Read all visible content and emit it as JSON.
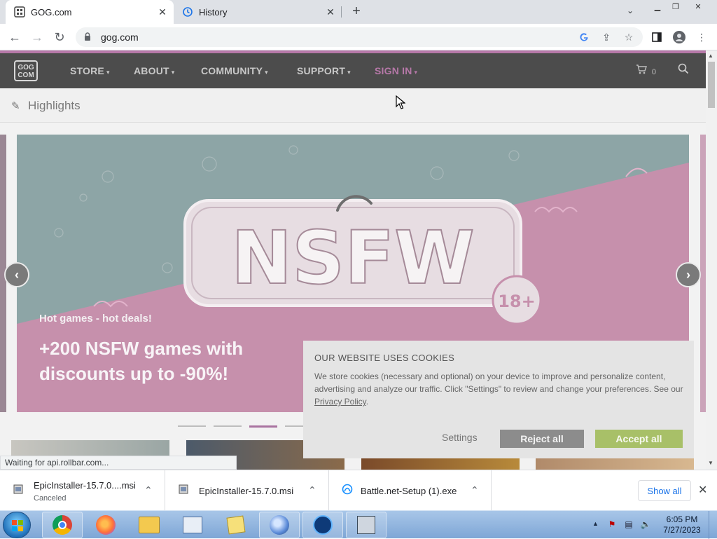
{
  "browser": {
    "tabs": [
      {
        "title": "GOG.com",
        "active": true
      },
      {
        "title": "History",
        "active": false
      }
    ],
    "url": "gog.com"
  },
  "gog": {
    "logo_text": "GOG COM",
    "menu": [
      {
        "label": "STORE"
      },
      {
        "label": "ABOUT"
      },
      {
        "label": "COMMUNITY"
      },
      {
        "label": "SUPPORT"
      },
      {
        "label": "SIGN IN"
      }
    ],
    "cart_count": "0",
    "section_title": "Highlights",
    "banner": {
      "art_text": "NSFW",
      "badge": "18+",
      "subtitle": "Hot games - hot deals!",
      "headline": "+200 NSFW games with discounts up to -90%!"
    }
  },
  "cookie": {
    "title": "OUR WEBSITE USES COOKIES",
    "body": "We store cookies (necessary and optional) on your device to improve and personalize content, advertising and analyze our traffic. Click \"Settings\" to review and change your preferences. See our",
    "link": "Privacy Policy",
    "link_suffix": ".",
    "settings_label": "Settings",
    "reject_label": "Reject all",
    "accept_label": "Accept all"
  },
  "status_text": "Waiting for api.rollbar.com...",
  "downloads": {
    "items": [
      {
        "name": "EpicInstaller-15.7.0....msi",
        "status": "Canceled"
      },
      {
        "name": "EpicInstaller-15.7.0.msi",
        "status": ""
      },
      {
        "name": "Battle.net-Setup (1).exe",
        "status": ""
      }
    ],
    "show_all_label": "Show all"
  },
  "taskbar": {
    "time": "6:05 PM",
    "date": "7/27/2023"
  },
  "colors": {
    "gog_header": "#4c4c4c",
    "gog_accent": "#b678a8",
    "accept_green": "#a8c068",
    "reject_gray": "#8c8c8c"
  }
}
